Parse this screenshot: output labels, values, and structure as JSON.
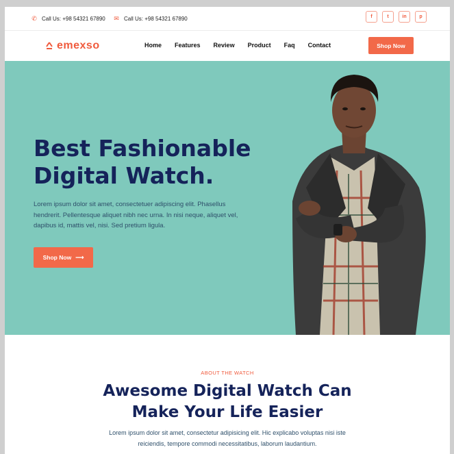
{
  "topbar": {
    "contacts": [
      {
        "icon": "phone-icon",
        "text": "Call Us: +98 54321 67890"
      },
      {
        "icon": "mail-icon",
        "text": "Call Us: +98 54321 67890"
      }
    ],
    "socials": [
      {
        "icon": "facebook-icon",
        "glyph": "f"
      },
      {
        "icon": "twitter-icon",
        "glyph": "t"
      },
      {
        "icon": "linkedin-icon",
        "glyph": "in"
      },
      {
        "icon": "pinterest-icon",
        "glyph": "p"
      }
    ]
  },
  "nav": {
    "logo": "emexso",
    "items": [
      "Home",
      "Features",
      "Review",
      "Product",
      "Faq",
      "Contact"
    ],
    "cta": "Shop Now"
  },
  "hero": {
    "title_line1": "Best Fashionable",
    "title_line2": "Digital Watch.",
    "text": "Lorem ipsum dolor sit amet, consectetuer adipiscing elit. Phasellus hendrerit. Pellentesque aliquet nibh nec urna. In nisi neque, aliquet vel, dapibus id, mattis vel, nisi. Sed pretium ligula.",
    "cta": "Shop Now",
    "arrow": "⟶"
  },
  "about": {
    "kicker": "ABOUT THE WATCH",
    "title_line1": "Awesome Digital Watch Can",
    "title_line2": "Make Your Life Easier",
    "text": "Lorem ipsum dolor sit amet, consectetur adipisicing elit. Hic explicabo voluptas nisi iste reiciendis, tempore commodi necessitatibus, laborum laudantium."
  },
  "colors": {
    "accent": "#f26949",
    "hero_bg": "#7fc9bc",
    "heading": "#15235a"
  }
}
